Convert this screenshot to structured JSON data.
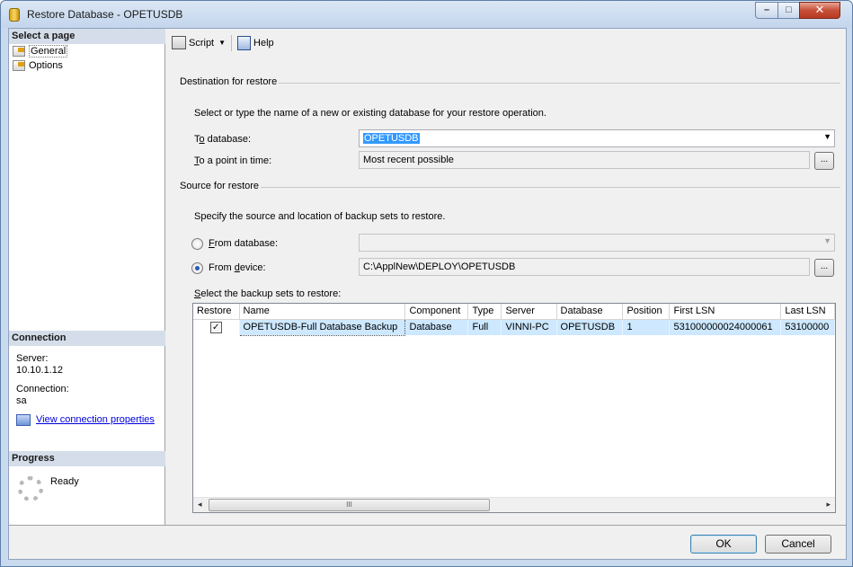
{
  "window": {
    "title": "Restore Database - OPETUSDB"
  },
  "sidebar": {
    "header": "Select a page",
    "pages": [
      {
        "label": "General"
      },
      {
        "label": "Options"
      }
    ],
    "connection": {
      "header": "Connection",
      "server_label": "Server:",
      "server_value": "10.10.1.12",
      "connection_label": "Connection:",
      "connection_value": "sa",
      "view_link": "View connection properties"
    },
    "progress": {
      "header": "Progress",
      "status": "Ready"
    }
  },
  "toolbar": {
    "script_label": "Script",
    "help_label": "Help"
  },
  "destination": {
    "group_title": "Destination for restore",
    "instruction": "Select or type the name of a new or existing database for your restore operation.",
    "to_database_label": "To database:",
    "to_database_value": "OPETUSDB",
    "point_in_time_label": "To a point in time:",
    "point_in_time_value": "Most recent possible",
    "browse_label": "..."
  },
  "source": {
    "group_title": "Source for restore",
    "instruction": "Specify the source and location of backup sets to restore.",
    "from_database_label": "From database:",
    "from_database_value": "",
    "from_device_label": "From device:",
    "from_device_value": "C:\\ApplNew\\DEPLOY\\OPETUSDB",
    "from_device_selected": true,
    "browse_label": "...",
    "backup_sets_label": "Select the backup sets to restore:"
  },
  "backup_grid": {
    "columns": [
      "Restore",
      "Name",
      "Component",
      "Type",
      "Server",
      "Database",
      "Position",
      "First LSN",
      "Last LSN"
    ],
    "rows": [
      {
        "restore": true,
        "name": "OPETUSDB-Full Database Backup",
        "component": "Database",
        "type": "Full",
        "server": "VINNI-PC",
        "database": "OPETUSDB",
        "position": "1",
        "first_lsn": "531000000024000061",
        "last_lsn": "53100000"
      }
    ],
    "scroll_grip": "III"
  },
  "buttons": {
    "ok": "OK",
    "cancel": "Cancel"
  }
}
